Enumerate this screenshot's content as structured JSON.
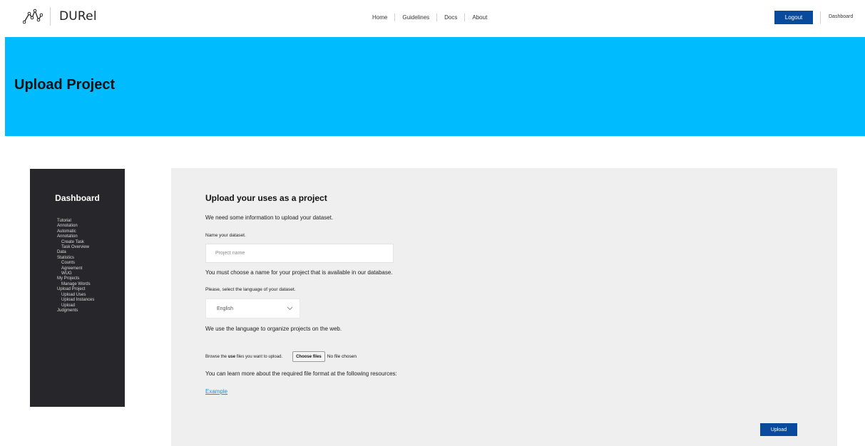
{
  "app": {
    "name": "DURel"
  },
  "nav": {
    "items": [
      "Home",
      "Guidelines",
      "Docs",
      "About"
    ],
    "logout_label": "Logout",
    "dashboard_label": "Dashboard"
  },
  "hero": {
    "title": "Upload Project"
  },
  "sidebar": {
    "title": "Dashboard",
    "items": [
      {
        "label": "Tutorial",
        "sub": false
      },
      {
        "label": "Annotation",
        "sub": false
      },
      {
        "label": "Automatic",
        "sub": false
      },
      {
        "label": "Annotation",
        "sub": false
      },
      {
        "label": "Create Task",
        "sub": true
      },
      {
        "label": "Task Overview",
        "sub": true
      },
      {
        "label": "Data",
        "sub": false
      },
      {
        "label": "Statistics",
        "sub": false
      },
      {
        "label": "Counts",
        "sub": true
      },
      {
        "label": "Agreement",
        "sub": true
      },
      {
        "label": "WUG",
        "sub": true
      },
      {
        "label": "My Projects",
        "sub": false
      },
      {
        "label": "Manage Words",
        "sub": true
      },
      {
        "label": "Upload Project",
        "sub": false
      },
      {
        "label": "Upload Uses",
        "sub": true
      },
      {
        "label": "Upload Instances",
        "sub": true
      },
      {
        "label": "Upload",
        "sub": true
      },
      {
        "label": "Judgments",
        "sub": false
      }
    ]
  },
  "form": {
    "title": "Upload your uses as a project",
    "intro": "We need some information to upload your dataset.",
    "name_label": "Name your dataset.",
    "name_placeholder": "Project name",
    "name_value": "",
    "name_hint": "You must choose a name for your project that is available in our database.",
    "language_label": "Please, select the language of your dataset.",
    "language_value": "English",
    "language_hint": "We use the language to organize projects on the web.",
    "file_label_pre": "Browse the ",
    "file_label_bold": "use",
    "file_label_post": " files you want to upload.",
    "choose_files_label": "Choose files",
    "no_file_label": "No file chosen",
    "resources_text": "You can learn more about the required file format at the following resources:",
    "example_link": "Example",
    "upload_label": "Upload"
  }
}
